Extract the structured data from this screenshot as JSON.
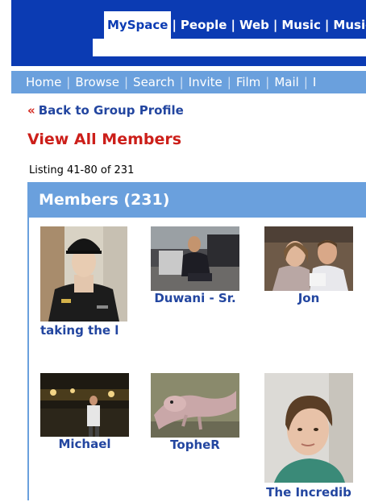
{
  "header": {
    "tabs": [
      {
        "label": "MySpace",
        "active": true
      },
      {
        "label": "People",
        "active": false
      },
      {
        "label": "Web",
        "active": false
      },
      {
        "label": "Music",
        "active": false
      },
      {
        "label": "Music",
        "active": false
      }
    ],
    "tab_separator": "|",
    "search_value": ""
  },
  "nav": {
    "links": [
      "Home",
      "Browse",
      "Search",
      "Invite",
      "Film",
      "Mail",
      "I"
    ],
    "separator": "|"
  },
  "back_link": {
    "arrow": "«",
    "label": "Back to Group Profile"
  },
  "page_title": "View All Members",
  "listing": "Listing 41-80 of 231",
  "members_panel": {
    "title": "Members (231)"
  },
  "members": [
    {
      "name": "taking the l",
      "photo": "soldier-in-uniform"
    },
    {
      "name": "Duwani - Sr.",
      "photo": "man-seated-office"
    },
    {
      "name": "Jon",
      "photo": "couple-smiling"
    },
    {
      "name": "Michael",
      "photo": "man-at-night-event"
    },
    {
      "name": "TopheR",
      "photo": "iguana"
    },
    {
      "name": "The Incredib",
      "photo": "woman-selfie"
    }
  ],
  "colors": {
    "header_blue": "#0b3bb3",
    "nav_blue": "#6aa0dd",
    "link_blue": "#2346a0",
    "title_red": "#cc1f1a"
  }
}
